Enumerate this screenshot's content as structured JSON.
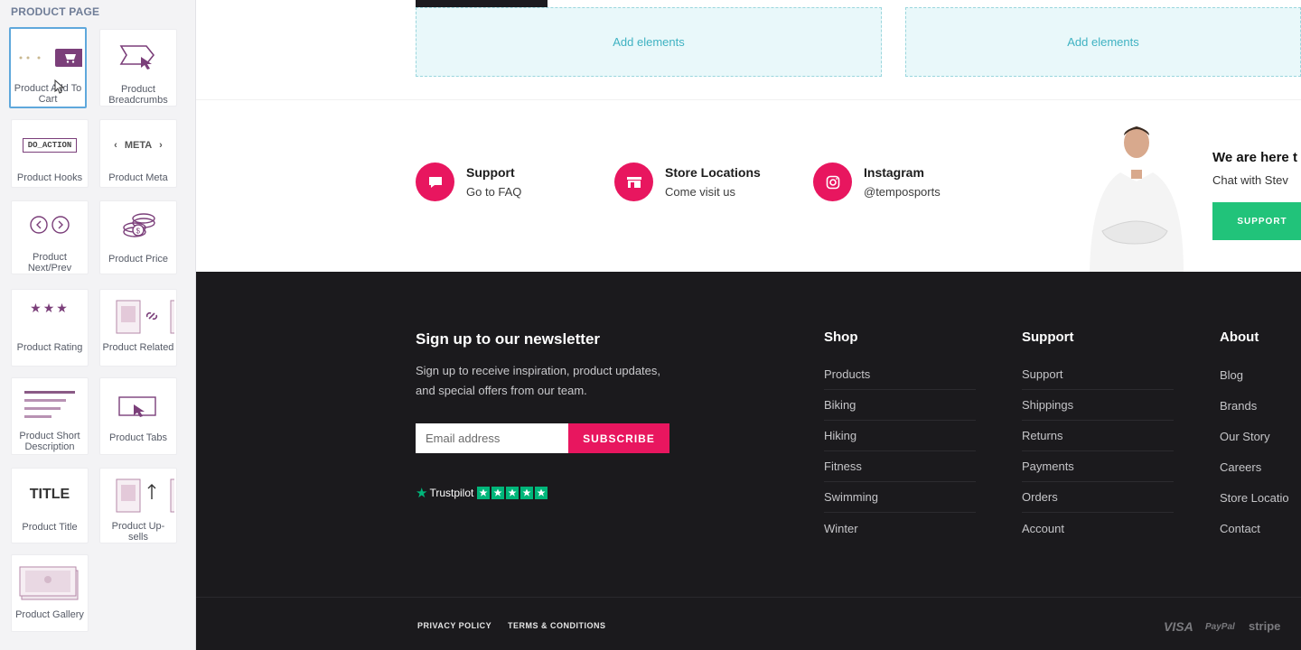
{
  "sidebar": {
    "heading": "PRODUCT PAGE",
    "widgets": [
      {
        "label": "Product Add To Cart",
        "icon": "cart-icon"
      },
      {
        "label": "Product Breadcrumbs",
        "icon": "breadcrumbs-icon"
      },
      {
        "label": "Product Hooks",
        "icon": "hooks-icon",
        "thumb_text": "DO_ACTION"
      },
      {
        "label": "Product Meta",
        "icon": "meta-icon",
        "thumb_text": "META"
      },
      {
        "label": "Product Next/Prev",
        "icon": "next-prev-icon"
      },
      {
        "label": "Product Price",
        "icon": "coins-icon"
      },
      {
        "label": "Product Rating",
        "icon": "stars-icon"
      },
      {
        "label": "Product Related",
        "icon": "related-icon"
      },
      {
        "label": "Product Short Description",
        "icon": "lines-icon"
      },
      {
        "label": "Product Tabs",
        "icon": "tabs-icon"
      },
      {
        "label": "Product Title",
        "icon": "title-icon",
        "thumb_text": "TITLE"
      },
      {
        "label": "Product Up-sells",
        "icon": "upsells-icon"
      },
      {
        "label": "Product Gallery",
        "icon": "gallery-icon"
      }
    ]
  },
  "canvas": {
    "add_elements": [
      "Add elements",
      "Add elements"
    ]
  },
  "info": [
    {
      "title": "Support",
      "subtitle": "Go to FAQ",
      "icon": "chat-icon"
    },
    {
      "title": "Store Locations",
      "subtitle": "Come visit us",
      "icon": "store-icon"
    },
    {
      "title": "Instagram",
      "subtitle": "@tempos​ports",
      "icon": "instagram-icon"
    }
  ],
  "promo": {
    "title": "We are here t",
    "subtitle": "Chat with Stev",
    "button": "SUPPORT"
  },
  "newsletter": {
    "title": "Sign up to our newsletter",
    "desc_line1": "Sign up to receive inspiration, product updates,",
    "desc_line2": "and special offers from our team.",
    "placeholder": "Email address",
    "button": "SUBSCRIBE",
    "trustpilot": "Trustpilot"
  },
  "columns": [
    {
      "title": "Shop",
      "items": [
        "Products",
        "Biking",
        "Hiking",
        "Fitness",
        "Swimming",
        "Winter"
      ]
    },
    {
      "title": "Support",
      "items": [
        "Support",
        "Shippings",
        "Returns",
        "Payments",
        "Orders",
        "Account"
      ]
    },
    {
      "title": "About",
      "items": [
        "Blog",
        "Brands",
        "Our Story",
        "Careers",
        "Store Locatio",
        "Contact"
      ]
    }
  ],
  "legal": {
    "privacy": "PRIVACY POLICY",
    "terms": "TERMS & CONDITIONS"
  },
  "payments": [
    "VISA",
    "PayPal",
    "stripe"
  ],
  "colors": {
    "accent": "#e8165f",
    "green": "#21c37a",
    "footer": "#1b1a1d",
    "add_box": "#e9f8fa"
  }
}
